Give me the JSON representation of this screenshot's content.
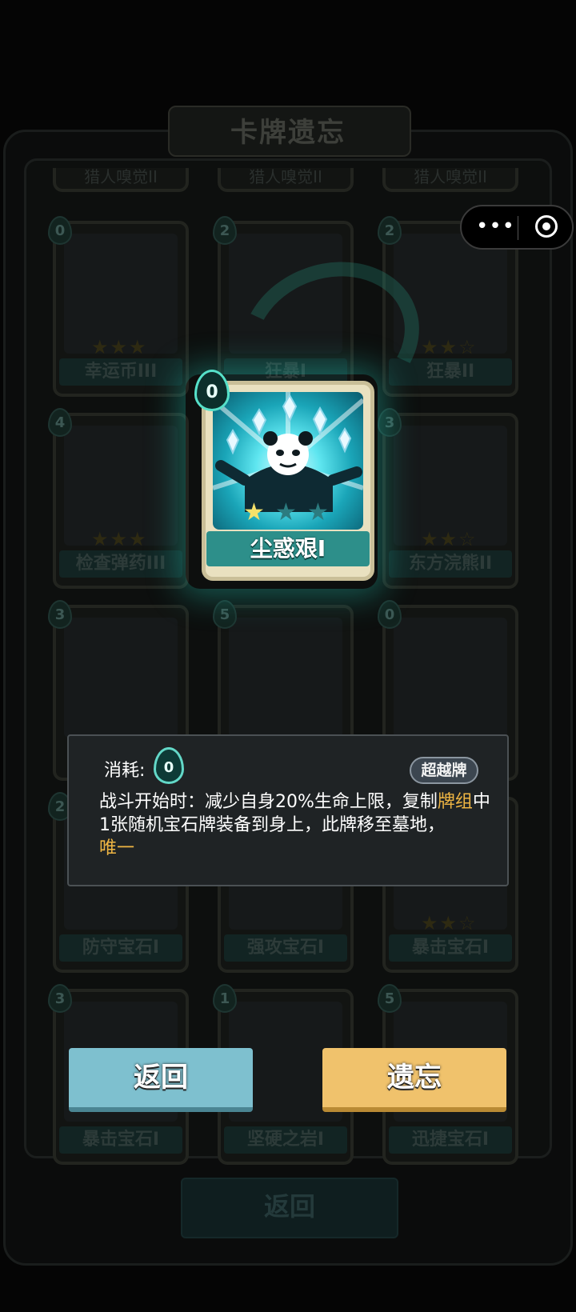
{
  "panel": {
    "title": "卡牌遗忘"
  },
  "top_row_labels": [
    "猎人嗅觉II",
    "猎人嗅觉II",
    "猎人嗅觉II"
  ],
  "cards": [
    {
      "cost": "0",
      "label": "幸运币III"
    },
    {
      "cost": "2",
      "label": "狂暴I"
    },
    {
      "cost": "2",
      "label": "狂暴II"
    },
    {
      "cost": "4",
      "label": "检查弹药III"
    },
    {
      "cost": "3",
      "label": "东方浣熊II"
    },
    {
      "cost": "3",
      "label": ""
    },
    {
      "cost": "5",
      "label": ""
    },
    {
      "cost": "0",
      "label": ""
    },
    {
      "cost": "2",
      "label": "防守宝石I"
    },
    {
      "cost": "",
      "label": "强攻宝石I"
    },
    {
      "cost": "",
      "label": "暴击宝石I"
    },
    {
      "cost": "3",
      "label": "暴击宝石I"
    },
    {
      "cost": "1",
      "label": "坚硬之岩I"
    },
    {
      "cost": "5",
      "label": "迅捷宝石I"
    }
  ],
  "selected_card": {
    "cost": "0",
    "label": "尘惑艰I",
    "stars_filled": 1,
    "stars_total": 3
  },
  "tooltip": {
    "cost_label": "消耗:",
    "cost_value": "0",
    "badge": "超越牌",
    "text_part1": "战斗开始时：减少自身20%生命上限，复制",
    "text_hl1": "牌组",
    "text_part2": "中1张随机宝石牌装备到身上，此牌移至墓地，",
    "text_hl2": "唯一"
  },
  "buttons": {
    "back": "返回",
    "forget": "遗忘",
    "bottom_back": "返回"
  },
  "capsule": {
    "more": "•••"
  },
  "colors": {
    "accent_teal": "#2d8f8a",
    "button_blue": "#7ec0cf",
    "button_gold": "#f0c26c",
    "highlight_text": "#f0b643"
  }
}
